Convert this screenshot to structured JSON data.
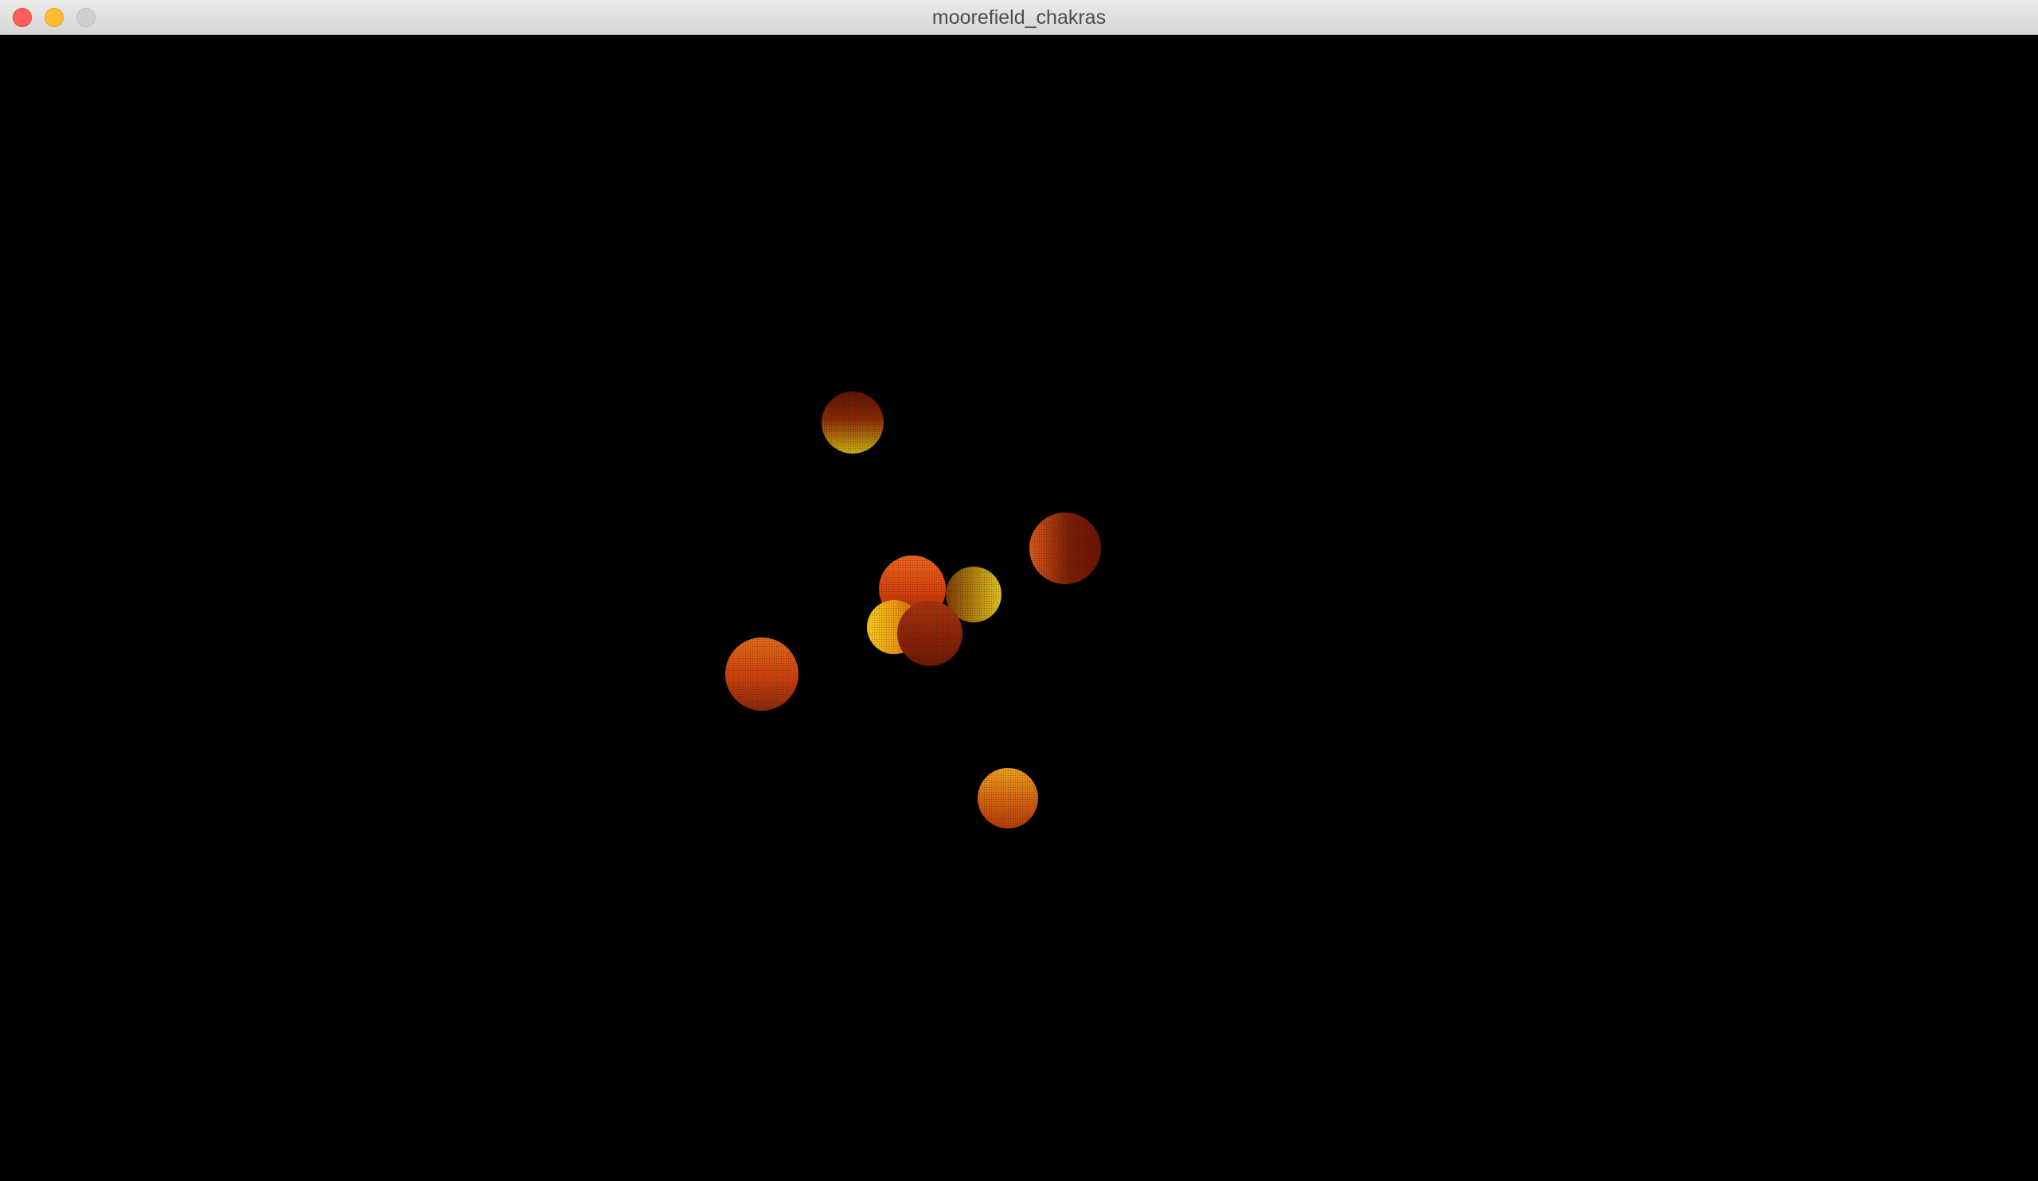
{
  "window": {
    "title": "moorefield_chakras"
  },
  "scene": {
    "background": "#000000",
    "spheres": [
      {
        "name": "sphere-1",
        "base": "#8a2a08",
        "light": "#c8b010",
        "shadow": "#5a1604",
        "light_dir": "bottom"
      },
      {
        "name": "sphere-2",
        "base": "#7a1e06",
        "light": "#d8581a",
        "shadow": "#6a1604",
        "light_dir": "left"
      },
      {
        "name": "sphere-3",
        "base": "#d4400c",
        "light": "#e86620",
        "shadow": "#9a2808",
        "light_dir": "top"
      },
      {
        "name": "sphere-4",
        "base": "#a8780e",
        "light": "#e0c020",
        "shadow": "#7a3a08",
        "light_dir": "right"
      },
      {
        "name": "sphere-5",
        "base": "#e8960e",
        "light": "#f4c81c",
        "shadow": "#c45a0a",
        "light_dir": "left"
      },
      {
        "name": "sphere-6",
        "base": "#8a2408",
        "light": "#a83410",
        "shadow": "#6a1a04",
        "light_dir": "top"
      },
      {
        "name": "sphere-7",
        "base": "#c8400e",
        "light": "#e06a1a",
        "shadow": "#8a2808",
        "light_dir": "top"
      },
      {
        "name": "sphere-8",
        "base": "#d06010",
        "light": "#e8a01c",
        "shadow": "#b03c0a",
        "light_dir": "top"
      }
    ]
  }
}
